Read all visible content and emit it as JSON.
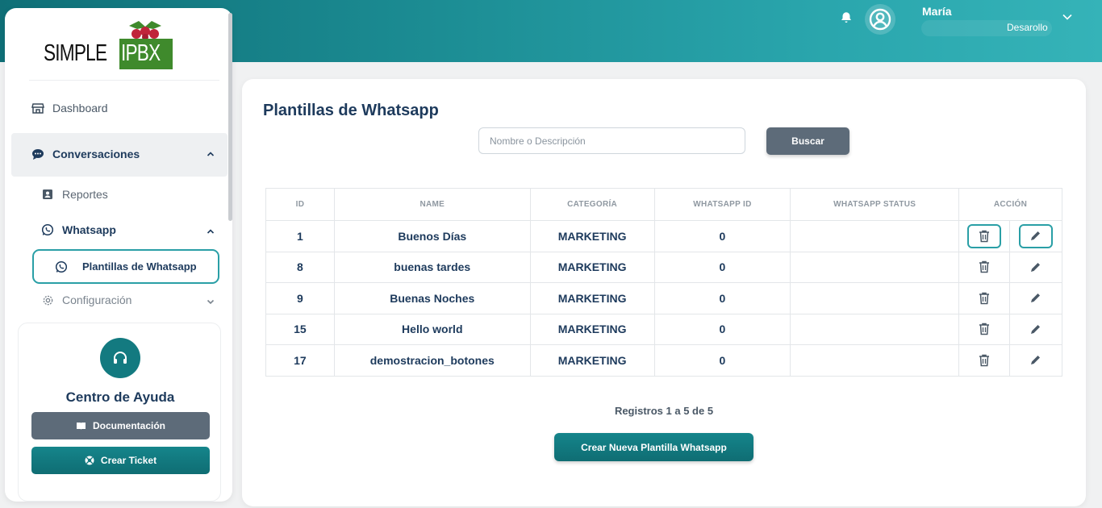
{
  "header": {
    "user_name": "María",
    "user_role": "Desarollo"
  },
  "logo": {
    "left": "SIMPLE",
    "right": "IPBX"
  },
  "sidebar": {
    "items": [
      {
        "label": "Dashboard",
        "icon": "store-icon"
      },
      {
        "label": "Conversaciones",
        "icon": "chat-bubble-icon",
        "expanded": true
      },
      {
        "label": "Reportes",
        "icon": "id-card-icon"
      },
      {
        "label": "Whatsapp",
        "icon": "whatsapp-icon",
        "expanded": true
      },
      {
        "label": "Plantillas de Whatsapp",
        "icon": "whatsapp-icon",
        "active": true
      },
      {
        "label": "Configuración",
        "icon": "gear-icon"
      }
    ],
    "help": {
      "title": "Centro de Ayuda",
      "documentation_label": "Documentación",
      "ticket_label": "Crear Ticket"
    }
  },
  "main": {
    "title": "Plantillas de Whatsapp",
    "search_placeholder": "Nombre o Descripción",
    "search_button": "Buscar",
    "columns": [
      "ID",
      "NAME",
      "CATEGORÍA",
      "WHATSAPP ID",
      "WHATSAPP STATUS",
      "ACCIÓN"
    ],
    "rows": [
      {
        "id": "1",
        "name": "Buenos Días",
        "category": "MARKETING",
        "whatsapp_id": "0",
        "status": ""
      },
      {
        "id": "8",
        "name": "buenas tardes",
        "category": "MARKETING",
        "whatsapp_id": "0",
        "status": ""
      },
      {
        "id": "9",
        "name": "Buenas Noches",
        "category": "MARKETING",
        "whatsapp_id": "0",
        "status": ""
      },
      {
        "id": "15",
        "name": "Hello world",
        "category": "MARKETING",
        "whatsapp_id": "0",
        "status": ""
      },
      {
        "id": "17",
        "name": "demostracion_botones",
        "category": "MARKETING",
        "whatsapp_id": "0",
        "status": ""
      }
    ],
    "records_text": "Registros 1 a 5 de 5",
    "create_button": "Crear Nueva Plantilla Whatsapp"
  },
  "colors": {
    "accent": "#137a80",
    "highlight": "#2a9fa6",
    "secondary": "#5d6b79",
    "text": "#1d3a5c"
  }
}
